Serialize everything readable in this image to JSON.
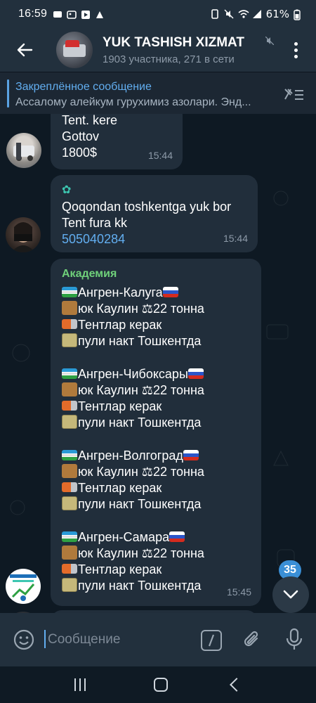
{
  "status_bar": {
    "time": "16:59",
    "battery": "61%"
  },
  "header": {
    "title": "YUK TASHISH XIZMAT",
    "subtitle": "1903 участника, 271 в сети"
  },
  "pinned": {
    "title": "Закреплённое сообщение",
    "text": "Ассалому алейкум гурухимиз азолари. Энд..."
  },
  "messages": [
    {
      "lines": [
        "Tent. kere",
        "Gottov",
        "1800$"
      ],
      "time": "15:44"
    },
    {
      "lines": [
        "Qoqondan toshkentga yuk bor",
        "Tent fura kk"
      ],
      "phone": "505040284",
      "time": "15:44"
    },
    {
      "sender": "Академия",
      "blocks": [
        {
          "route": "Ангрен-Калуга",
          "cargo": "юк Каулин",
          "weight": "22 тонна",
          "truck": "Тентлар керак",
          "pay": "пули накт Тошкентда"
        },
        {
          "route": "Ангрен-Чибоксары",
          "cargo": "юк Каулин",
          "weight": "22 тонна",
          "truck": "Тентлар керак",
          "pay": "пули накт Тошкентда"
        },
        {
          "route": "Ангрен-Волгоград",
          "cargo": "юк Каулин",
          "weight": "22 тонна",
          "truck": "Тентлар керак",
          "pay": "пули накт Тошкентда"
        },
        {
          "route": "Ангрен-Самара",
          "cargo": "юк Каулин",
          "weight": "22 тонна",
          "truck": "Тентлар керак",
          "pay": "пули накт Тошкентда"
        }
      ],
      "time": "15:45"
    }
  ],
  "unread_badge": "35",
  "input": {
    "placeholder": "Сообщение"
  },
  "colors": {
    "accent": "#62aef0",
    "sender": "#6fd07a",
    "bubble": "#212e3b",
    "header": "#22303d"
  }
}
